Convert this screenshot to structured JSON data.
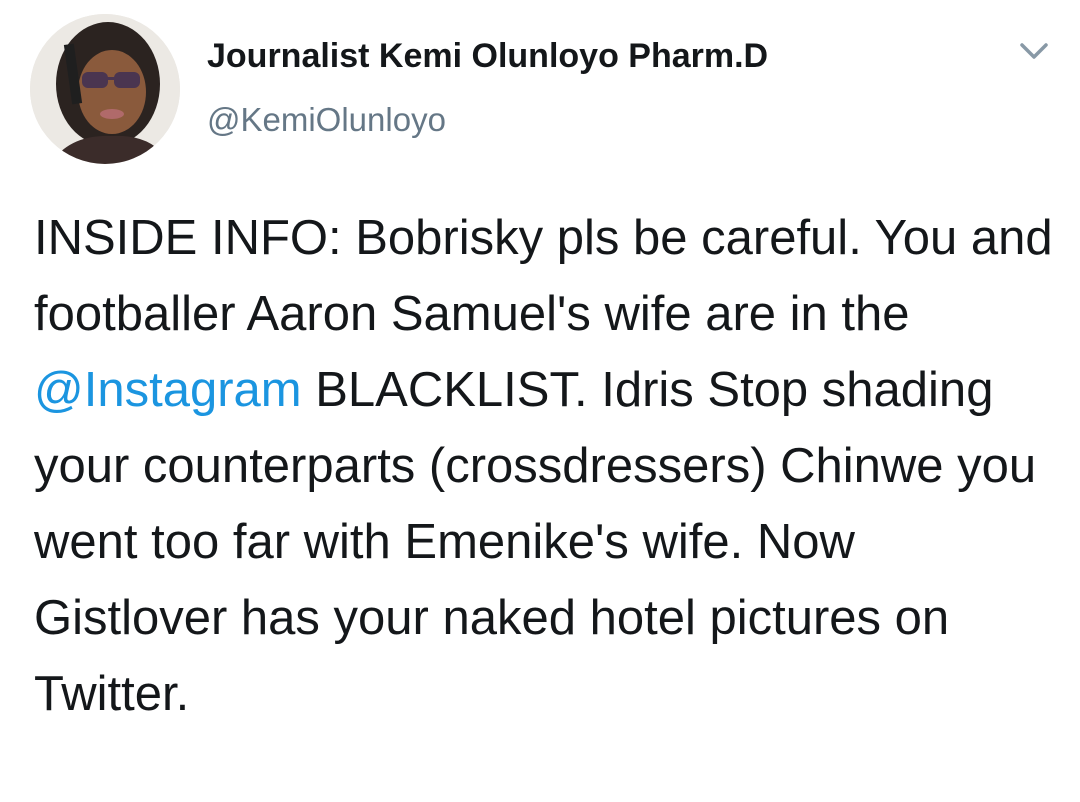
{
  "tweet": {
    "author": {
      "display_name": "Journalist Kemi Olunloyo Pharm.D",
      "handle": "@KemiOlunloyo",
      "avatar_icon": "profile-photo"
    },
    "menu_icon": "chevron-down-icon",
    "text": {
      "part1": "INSIDE INFO: Bobrisky pls be careful. You and footballer Aaron Samuel's wife are in the ",
      "mention": "@Instagram",
      "part2": " BLACKLIST. Idris Stop shading your counterparts (crossdressers) Chinwe you went too far with Emenike's wife. Now Gistlover has your naked hotel pictures on Twitter."
    },
    "colors": {
      "text": "#14171a",
      "handle": "#657786",
      "link": "#1b95e0",
      "background": "#ffffff"
    }
  }
}
